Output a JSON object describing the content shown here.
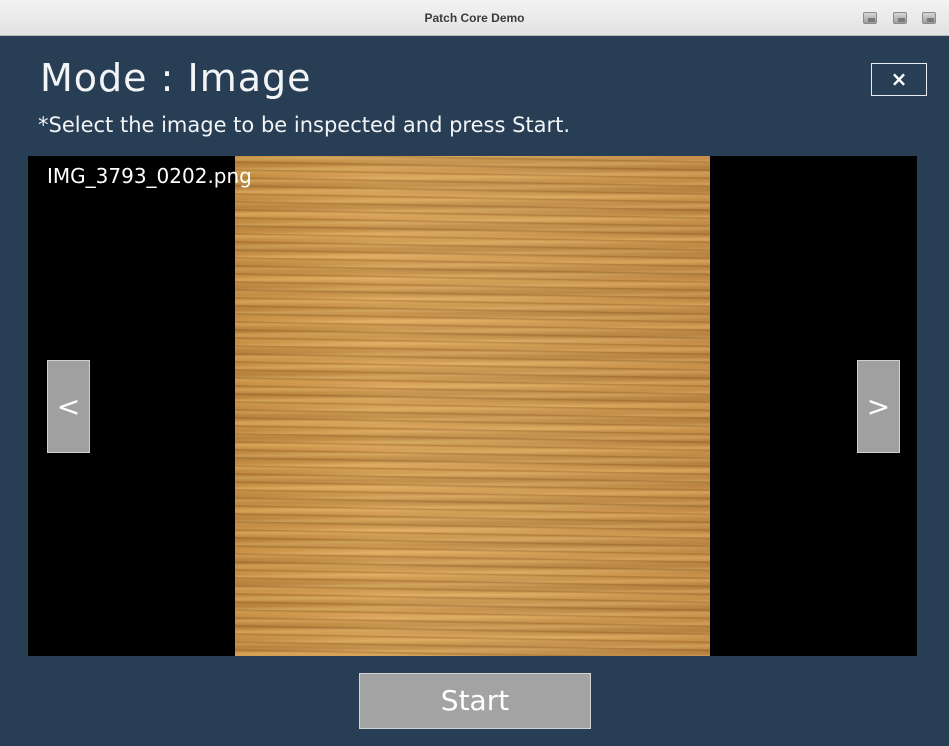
{
  "window": {
    "title": "Patch Core Demo",
    "controls": [
      "minimize-icon",
      "maximize-icon",
      "close-window-icon"
    ]
  },
  "header": {
    "mode_title": "Mode : Image",
    "close_label": "×",
    "instruction": "*Select the image to be inspected and press Start."
  },
  "viewer": {
    "filename": "IMG_3793_0202.png",
    "prev_label": "<",
    "next_label": ">"
  },
  "actions": {
    "start_label": "Start"
  },
  "colors": {
    "background": "#283e55",
    "button_gray": "#a0a0a0",
    "viewer_bg": "#000000"
  }
}
